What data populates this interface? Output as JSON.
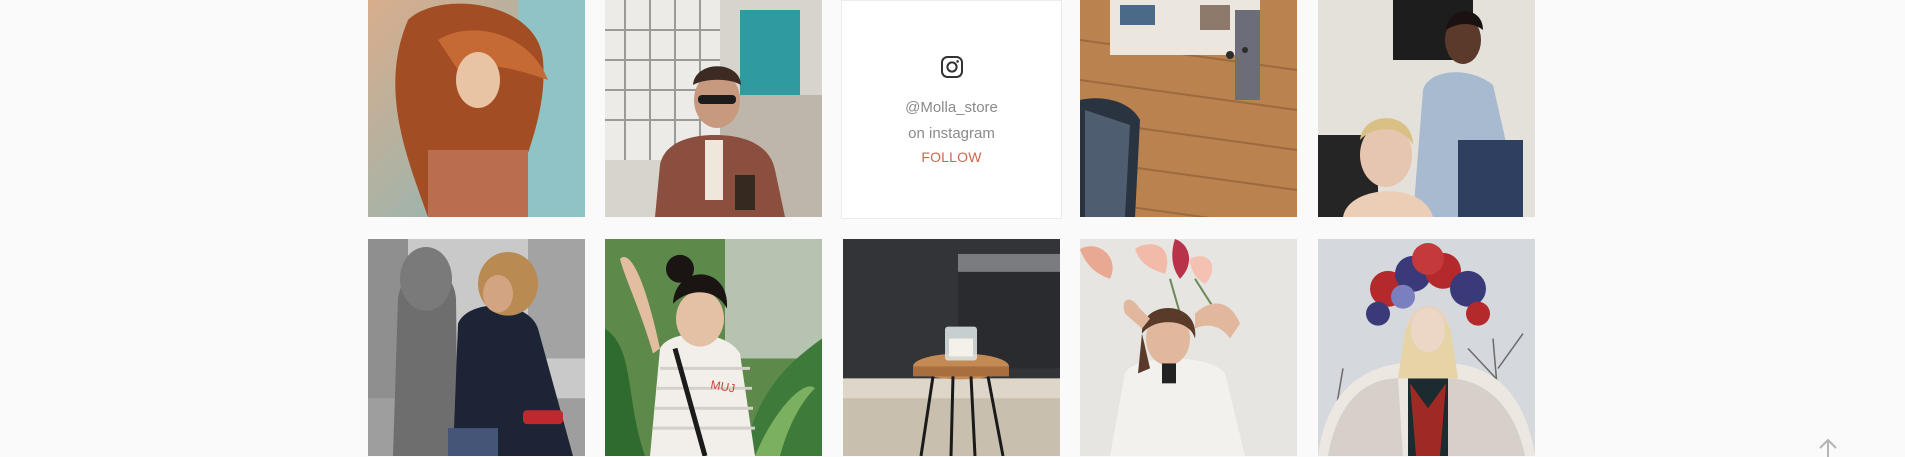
{
  "instagram": {
    "handle": "@Molla_store",
    "subtext": "on instagram",
    "follow_label": "FOLLOW",
    "icon": "instagram-icon",
    "follow_color": "#c96a4d"
  },
  "gallery": {
    "photos": [
      {
        "name": "photo-woman-windswept-hair"
      },
      {
        "name": "photo-man-sunglasses-cafe"
      },
      {
        "name": "photo-store-floor-clothing-rack"
      },
      {
        "name": "photo-two-women-portrait"
      },
      {
        "name": "photo-mother-child-street"
      },
      {
        "name": "photo-woman-tropical-plants"
      },
      {
        "name": "photo-stool-candle-interior"
      },
      {
        "name": "photo-woman-flowers"
      },
      {
        "name": "photo-woman-floral-crown"
      }
    ]
  },
  "scroll_top": {
    "icon": "arrow-up-icon"
  }
}
